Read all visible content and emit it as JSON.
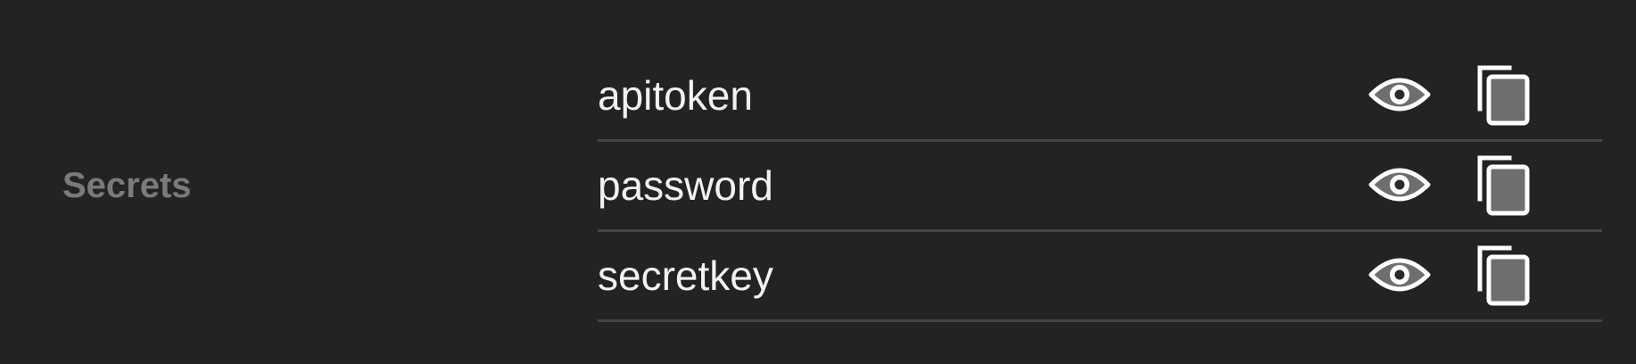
{
  "section": {
    "label": "Secrets"
  },
  "secrets": [
    {
      "name": "apitoken",
      "reveal_icon": "eye-icon",
      "copy_icon": "copy-icon"
    },
    {
      "name": "password",
      "reveal_icon": "eye-icon",
      "copy_icon": "copy-icon"
    },
    {
      "name": "secretkey",
      "reveal_icon": "eye-icon",
      "copy_icon": "copy-icon"
    }
  ],
  "colors": {
    "background": "#232323",
    "label": "#7a7a7a",
    "text": "#f2f2f2",
    "divider": "#444444",
    "icon_fill": "#6e6e6e",
    "icon_stroke": "#ffffff"
  }
}
